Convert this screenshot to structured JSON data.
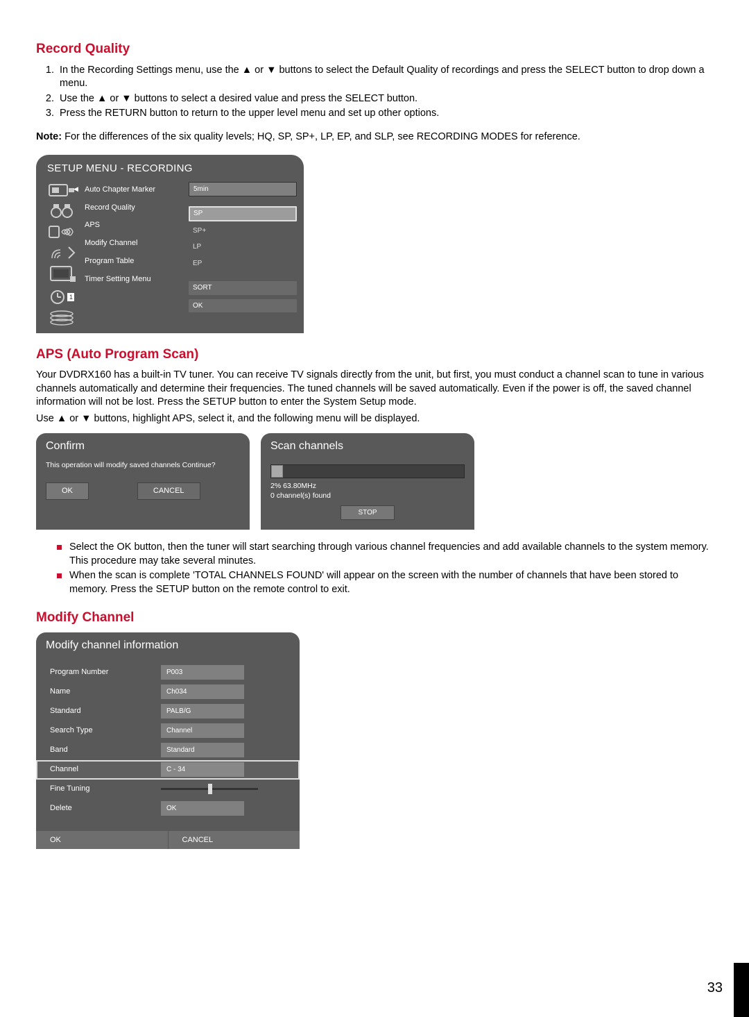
{
  "page_number": "33",
  "sections": {
    "record_quality": {
      "heading": "Record Quality",
      "steps": [
        "In the Recording Settings menu, use the ▲ or ▼ buttons to select the  Default Quality of recordings and press the SELECT button to drop down a menu.",
        "Use the ▲ or ▼ buttons to select a desired value and press the SELECT button.",
        "Press the RETURN button to return to the upper level menu and set up other options."
      ],
      "note_label": "Note:",
      "note_text": " For the differences of the six quality levels; HQ, SP, SP+, LP, EP, and SLP, see RECORDING MODES for reference."
    },
    "aps": {
      "heading": "APS (Auto Program Scan)",
      "para1": "Your DVDRX160 has a built-in TV tuner. You can receive TV signals directly from the unit, but first, you must conduct a channel scan to tune in various channels automatically and determine their frequencies. The tuned channels will be saved automatically. Even if the power is off, the saved channel information will not be lost. Press the SETUP button to enter the System Setup mode.",
      "para2": "Use ▲ or ▼ buttons, highlight APS, select it, and the following menu will be displayed.",
      "bullets": [
        "Select the OK button, then the tuner will start searching through various channel frequencies and add available channels to the system memory. This procedure may take several minutes.",
        "When the scan is complete 'TOTAL CHANNELS FOUND' will appear on the screen with the number of channels that have been stored to memory. Press the SETUP button on the remote control to exit."
      ]
    },
    "modify_channel": {
      "heading": "Modify Channel"
    }
  },
  "setup_menu": {
    "title": "SETUP MENU - RECORDING",
    "items": [
      "Auto Chapter Marker",
      "Record Quality",
      "APS",
      "Modify Channel",
      "Program Table",
      "Timer Setting Menu"
    ],
    "value_top": "5min",
    "quality_selected": "SP",
    "quality_options": [
      "SP+",
      "LP",
      "EP"
    ],
    "sort_label": "SORT",
    "ok_label": "OK"
  },
  "confirm_dialog": {
    "title": "Confirm",
    "message": "This operation will modify saved channels Continue?",
    "ok": "OK",
    "cancel": "CANCEL"
  },
  "scan_dialog": {
    "title": "Scan channels",
    "progress_text": "2% 63.80MHz",
    "found_text": "0 channel(s) found",
    "stop": "STOP"
  },
  "modify_dialog": {
    "title": "Modify channel information",
    "rows": [
      {
        "label": "Program Number",
        "value": "P003"
      },
      {
        "label": "Name",
        "value": "Ch034"
      },
      {
        "label": "Standard",
        "value": "PALB/G"
      },
      {
        "label": "Search Type",
        "value": "Channel"
      },
      {
        "label": "Band",
        "value": "Standard"
      },
      {
        "label": "Channel",
        "value": "C - 34"
      },
      {
        "label": "Fine Tuning",
        "value": ""
      },
      {
        "label": "Delete",
        "value": "OK"
      }
    ],
    "footer_ok": "OK",
    "footer_cancel": "CANCEL"
  }
}
